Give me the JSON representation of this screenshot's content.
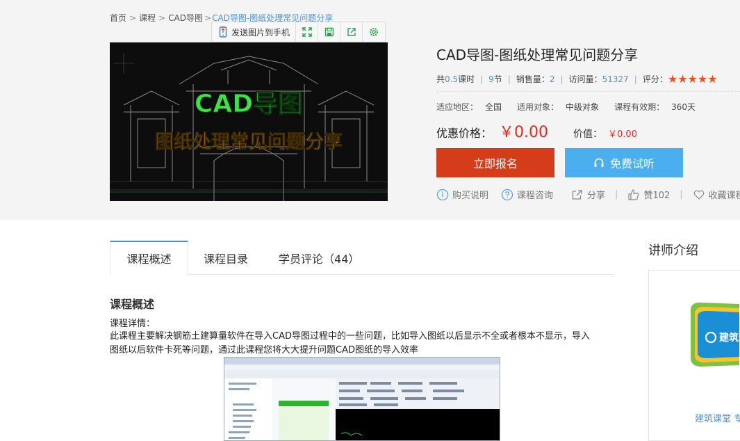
{
  "breadcrumb": {
    "home": "首页",
    "courses": "课程",
    "category": "CAD导图",
    "current": "CAD导图-图纸处理常见问题分享"
  },
  "toolbar": {
    "send_label": "发送图片到手机"
  },
  "cover": {
    "title_line1": "CAD导图",
    "title_line2": "图纸处理常见问题分享"
  },
  "course": {
    "title": "CAD导图-图纸处理常见问题分享",
    "hours_prefix": "共",
    "hours_value": "0.5",
    "hours_suffix": "课时",
    "sections_value": "9",
    "sections_suffix": "节",
    "sales_label": "销售量：",
    "sales_value": "2",
    "visits_label": "访问量：",
    "visits_value": "51327",
    "rating_label": "评分：",
    "rating_stars": "★★★★★",
    "region_label": "适应地区：",
    "region_value": "全国",
    "audience_label": "适用对象：",
    "audience_value": "中级对象",
    "validity_label": "课程有效期：",
    "validity_value": "360天",
    "price_label": "优惠价格：",
    "price_value": "￥0.00",
    "orig_label": "价值：",
    "orig_value": "￥0.00"
  },
  "buttons": {
    "enroll": "立即报名",
    "trial": "免费试听"
  },
  "actions": {
    "buy_info": "购买说明",
    "consult": "课程咨询",
    "share": "分享",
    "like": "赞102",
    "favorite": "收藏课程"
  },
  "tabs": [
    "课程概述",
    "课程目录",
    "学员评论（44）"
  ],
  "content": {
    "section_title": "课程概述",
    "detail_label": "课程详情：",
    "description": "此课程主要解决钢筋土建算量软件在导入CAD导图过程中的一些问题，比如导入图纸以后显示不全或者根本不显示，导入图纸以后软件卡死等问题，通过此课程您将大大提升问题CAD图纸的导入效率"
  },
  "teacher": {
    "section_title": "讲师介绍",
    "logo_text": "建筑课",
    "name": "建筑课堂 专"
  },
  "colors": {
    "accent_blue": "#4a90d9",
    "enroll_red": "#d53d1a",
    "trial_blue": "#4baeee",
    "price_red": "#e8281f",
    "star_orange": "#e8521d"
  }
}
